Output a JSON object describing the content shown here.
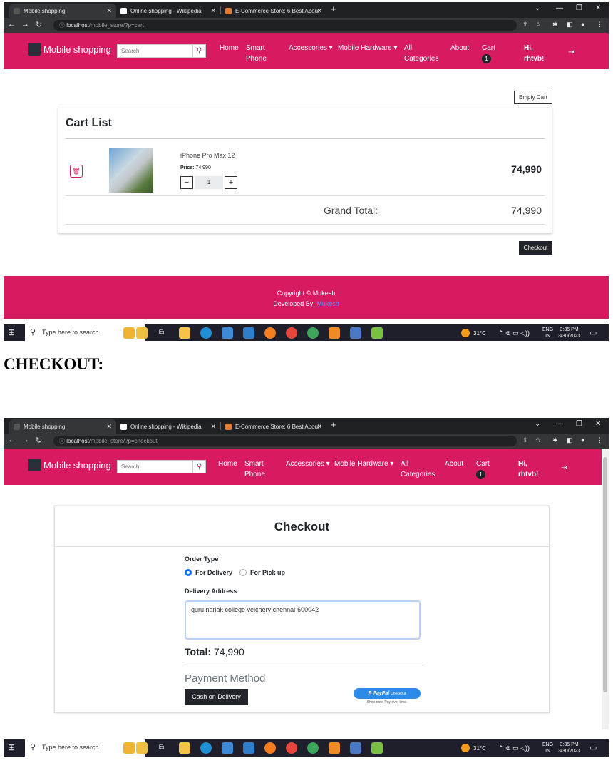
{
  "browser": {
    "tabs": [
      "Mobile shopping",
      "Online shopping - Wikipedia",
      "E-Commerce Store: 6 Best About"
    ],
    "url_cart": {
      "host": "localhost",
      "path": "/mobile_store/?p=cart"
    },
    "url_checkout": {
      "host": "localhost",
      "path": "/mobile_store/?p=checkout"
    }
  },
  "navbar": {
    "brand": "Mobile shopping",
    "search_placeholder": "Search",
    "home": "Home",
    "smart_phone_1": "Smart",
    "smart_phone_2": "Phone",
    "accessories": "Accessories ▾",
    "mobile_hardware": "Mobile Hardware ▾",
    "all_categories_1": "All",
    "all_categories_2": "Categories",
    "about": "About",
    "cart": "Cart",
    "cart_count": "1",
    "greeting_1": "Hi,",
    "greeting_2": "rhtvb!"
  },
  "cart": {
    "empty_cart": "Empty Cart",
    "title": "Cart List",
    "item_name": "iPhone Pro Max 12",
    "price_label": "Price:",
    "price_value": "74,990",
    "qty_minus": "−",
    "qty_plus": "+",
    "quantity": "1",
    "item_total": "74,990",
    "grand_total_label": "Grand Total:",
    "grand_total": "74,990",
    "checkout_button": "Checkout"
  },
  "footer": {
    "copyright": "Copyright © Mukesh",
    "developed_by": "Developed By:",
    "developer_link": "Mukesh"
  },
  "taskbar": {
    "search_placeholder": "Type here to search",
    "temperature": "31°C",
    "lang_1": "ENG",
    "lang_2": "IN",
    "time": "3:35 PM",
    "date": "3/30/2023"
  },
  "section_heading": "CHECKOUT:",
  "checkout": {
    "title": "Checkout",
    "order_type_label": "Order Type",
    "option_delivery": "For Delivery",
    "option_pickup": "For Pick up",
    "delivery_address_label": "Delivery Address",
    "delivery_address_value": "guru nanak college velchery chennai-600042",
    "total_label": "Total:",
    "total_value": "74,990",
    "payment_method_label": "Payment Method",
    "cod_button": "Cash on Delivery",
    "paypal_label": "PayPal",
    "paypal_checkout": "Checkout",
    "paypal_tagline": "Shop now. Pay over time."
  }
}
